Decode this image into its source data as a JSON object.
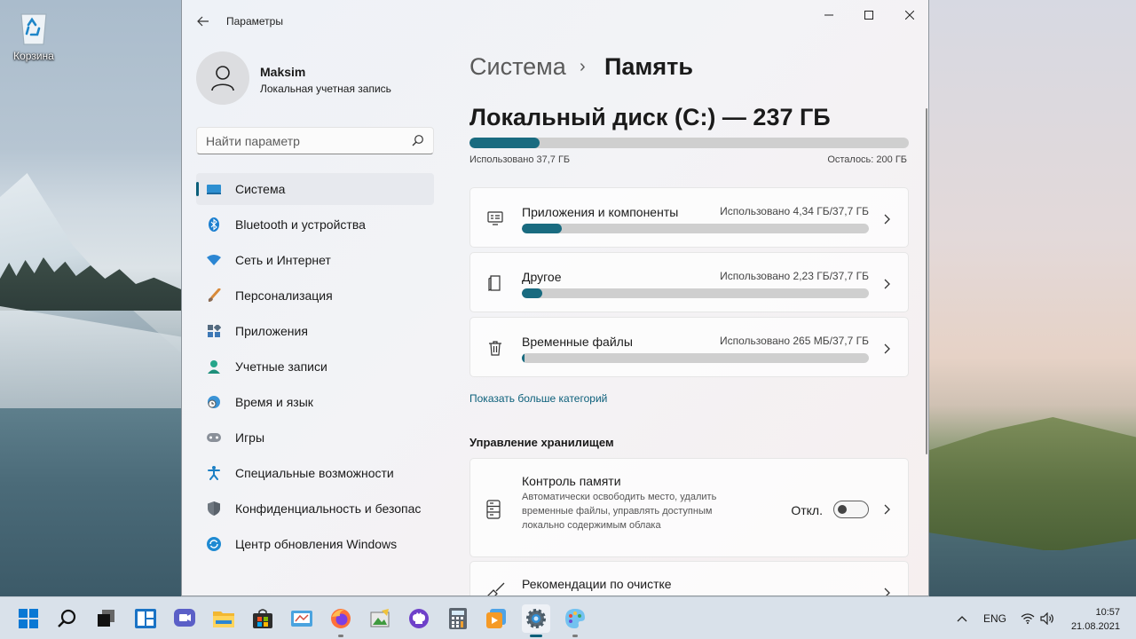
{
  "desktop": {
    "recycle_bin_label": "Корзина"
  },
  "window": {
    "app_title": "Параметры",
    "profile": {
      "name": "Maksim",
      "account_type": "Локальная учетная запись"
    },
    "search": {
      "placeholder": "Найти параметр"
    },
    "nav": [
      {
        "label": "Система",
        "icon": "monitor-icon",
        "active": true
      },
      {
        "label": "Bluetooth и устройства",
        "icon": "bluetooth-icon"
      },
      {
        "label": "Сеть и Интернет",
        "icon": "wifi-icon"
      },
      {
        "label": "Персонализация",
        "icon": "brush-icon"
      },
      {
        "label": "Приложения",
        "icon": "apps-icon"
      },
      {
        "label": "Учетные записи",
        "icon": "person-icon"
      },
      {
        "label": "Время и язык",
        "icon": "clock-globe-icon"
      },
      {
        "label": "Игры",
        "icon": "gamepad-icon"
      },
      {
        "label": "Специальные возможности",
        "icon": "accessibility-icon"
      },
      {
        "label": "Конфиденциальность и безопасность",
        "icon": "shield-icon"
      },
      {
        "label": "Центр обновления Windows",
        "icon": "update-icon"
      }
    ]
  },
  "main": {
    "breadcrumb": {
      "root": "Система",
      "separator": "›",
      "page": "Память"
    },
    "disk": {
      "title": "Локальный диск (C:) — 237 ГБ",
      "used_text": "Использовано 37,7 ГБ",
      "free_text": "Осталось: 200 ГБ",
      "used_fraction": 0.159
    },
    "categories": [
      {
        "name": "Приложения и компоненты",
        "used_text": "Использовано 4,34 ГБ/37,7 ГБ",
        "fraction": 0.115,
        "icon": "apps-list-icon"
      },
      {
        "name": "Другое",
        "used_text": "Использовано 2,23 ГБ/37,7 ГБ",
        "fraction": 0.059,
        "icon": "document-icon"
      },
      {
        "name": "Временные файлы",
        "used_text": "Использовано 265 МБ/37,7 ГБ",
        "fraction": 0.007,
        "icon": "trash-icon"
      }
    ],
    "more_link": "Показать больше категорий",
    "section_title": "Управление хранилищем",
    "storage_sense": {
      "title": "Контроль памяти",
      "description": "Автоматически освободить место, удалить временные файлы, управлять доступным локально содержимым облака",
      "toggle_label": "Откл.",
      "toggle_on": false
    },
    "cleanup": {
      "title": "Рекомендации по очистке"
    }
  },
  "taskbar": {
    "apps": [
      "start-icon",
      "search-icon",
      "task-view-icon",
      "widgets-icon",
      "chat-icon",
      "file-explorer-icon",
      "store-icon",
      "control-panel-icon",
      "firefox-icon",
      "image-editor-icon",
      "github-icon",
      "calculator-icon",
      "media-player-icon",
      "settings-icon",
      "paint-icon"
    ],
    "language": "ENG",
    "time": "10:57",
    "date": "21.08.2021"
  },
  "colors": {
    "accent": "#196b80",
    "link": "#0b5f7a"
  }
}
